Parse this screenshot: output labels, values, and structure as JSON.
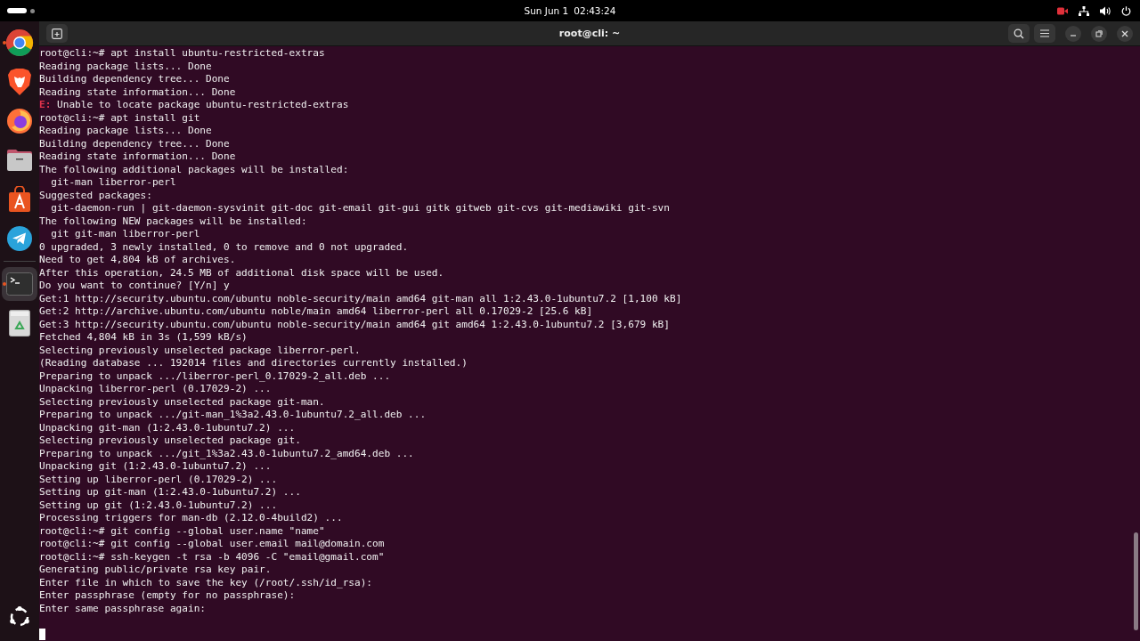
{
  "top_bar": {
    "date": "Sun Jun 1",
    "time": "02:43:24",
    "recording": true
  },
  "dock": {
    "items": [
      {
        "kind": "chrome",
        "running": true,
        "selected": false
      },
      {
        "kind": "brave",
        "running": false,
        "selected": false
      },
      {
        "kind": "firefox",
        "running": false,
        "selected": false
      },
      {
        "kind": "files",
        "running": false,
        "selected": false
      },
      {
        "kind": "appcenter",
        "running": false,
        "selected": false
      },
      {
        "kind": "telegram",
        "running": false,
        "selected": false
      },
      {
        "kind": "terminal",
        "running": true,
        "selected": true
      },
      {
        "kind": "trash",
        "running": false,
        "selected": false
      }
    ]
  },
  "window": {
    "title": "root@cli: ~"
  },
  "terminal": {
    "cursor_visible": true,
    "lines": [
      {
        "kind": "prompt",
        "text": "root@cli:~# apt install ubuntu-restricted-extras"
      },
      {
        "kind": "output",
        "text": "Reading package lists... Done"
      },
      {
        "kind": "output",
        "text": "Building dependency tree... Done"
      },
      {
        "kind": "output",
        "text": "Reading state information... Done"
      },
      {
        "kind": "error",
        "prefix": "E:",
        "text": "Unable to locate package ubuntu-restricted-extras"
      },
      {
        "kind": "prompt",
        "text": "root@cli:~# apt install git"
      },
      {
        "kind": "output",
        "text": "Reading package lists... Done"
      },
      {
        "kind": "output",
        "text": "Building dependency tree... Done"
      },
      {
        "kind": "output",
        "text": "Reading state information... Done"
      },
      {
        "kind": "output",
        "text": "The following additional packages will be installed:"
      },
      {
        "kind": "output",
        "text": "  git-man liberror-perl"
      },
      {
        "kind": "output",
        "text": "Suggested packages:"
      },
      {
        "kind": "output",
        "text": "  git-daemon-run | git-daemon-sysvinit git-doc git-email git-gui gitk gitweb git-cvs git-mediawiki git-svn"
      },
      {
        "kind": "output",
        "text": "The following NEW packages will be installed:"
      },
      {
        "kind": "output",
        "text": "  git git-man liberror-perl"
      },
      {
        "kind": "output",
        "text": "0 upgraded, 3 newly installed, 0 to remove and 0 not upgraded."
      },
      {
        "kind": "output",
        "text": "Need to get 4,804 kB of archives."
      },
      {
        "kind": "output",
        "text": "After this operation, 24.5 MB of additional disk space will be used."
      },
      {
        "kind": "output",
        "text": "Do you want to continue? [Y/n] y"
      },
      {
        "kind": "output",
        "text": "Get:1 http://security.ubuntu.com/ubuntu noble-security/main amd64 git-man all 1:2.43.0-1ubuntu7.2 [1,100 kB]"
      },
      {
        "kind": "output",
        "text": "Get:2 http://archive.ubuntu.com/ubuntu noble/main amd64 liberror-perl all 0.17029-2 [25.6 kB]"
      },
      {
        "kind": "output",
        "text": "Get:3 http://security.ubuntu.com/ubuntu noble-security/main amd64 git amd64 1:2.43.0-1ubuntu7.2 [3,679 kB]"
      },
      {
        "kind": "output",
        "text": "Fetched 4,804 kB in 3s (1,599 kB/s)"
      },
      {
        "kind": "output",
        "text": "Selecting previously unselected package liberror-perl."
      },
      {
        "kind": "output",
        "text": "(Reading database ... 192014 files and directories currently installed.)"
      },
      {
        "kind": "output",
        "text": "Preparing to unpack .../liberror-perl_0.17029-2_all.deb ..."
      },
      {
        "kind": "output",
        "text": "Unpacking liberror-perl (0.17029-2) ..."
      },
      {
        "kind": "output",
        "text": "Selecting previously unselected package git-man."
      },
      {
        "kind": "output",
        "text": "Preparing to unpack .../git-man_1%3a2.43.0-1ubuntu7.2_all.deb ..."
      },
      {
        "kind": "output",
        "text": "Unpacking git-man (1:2.43.0-1ubuntu7.2) ..."
      },
      {
        "kind": "output",
        "text": "Selecting previously unselected package git."
      },
      {
        "kind": "output",
        "text": "Preparing to unpack .../git_1%3a2.43.0-1ubuntu7.2_amd64.deb ..."
      },
      {
        "kind": "output",
        "text": "Unpacking git (1:2.43.0-1ubuntu7.2) ..."
      },
      {
        "kind": "output",
        "text": "Setting up liberror-perl (0.17029-2) ..."
      },
      {
        "kind": "output",
        "text": "Setting up git-man (1:2.43.0-1ubuntu7.2) ..."
      },
      {
        "kind": "output",
        "text": "Setting up git (1:2.43.0-1ubuntu7.2) ..."
      },
      {
        "kind": "output",
        "text": "Processing triggers for man-db (2.12.0-4build2) ..."
      },
      {
        "kind": "prompt",
        "text": "root@cli:~# git config --global user.name \"name\""
      },
      {
        "kind": "prompt",
        "text": "root@cli:~# git config --global user.email mail@domain.com"
      },
      {
        "kind": "prompt",
        "text": "root@cli:~# ssh-keygen -t rsa -b 4096 -C \"email@gmail.com\""
      },
      {
        "kind": "output",
        "text": "Generating public/private rsa key pair."
      },
      {
        "kind": "output",
        "text": "Enter file in which to save the key (/root/.ssh/id_rsa):"
      },
      {
        "kind": "output",
        "text": "Enter passphrase (empty for no passphrase):"
      },
      {
        "kind": "output",
        "text": "Enter same passphrase again:"
      }
    ]
  }
}
